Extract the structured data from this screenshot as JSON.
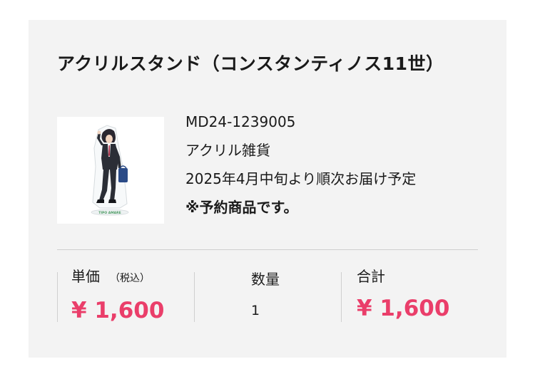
{
  "product": {
    "title": "アクリルスタンド（コンスタンティノス11世）",
    "image_caption": "TIPO AMARE",
    "code": "MD24-1239005",
    "category": "アクリル雑貨",
    "shipping": "2025年4月中旬より順次お届け予定",
    "notice": "※予約商品です。"
  },
  "summary": {
    "unit_price_label": "単価",
    "tax_note": "（税込）",
    "unit_price": "¥ 1,600",
    "quantity_label": "数量",
    "quantity": "1",
    "total_label": "合計",
    "total": "¥ 1,600"
  },
  "colors": {
    "price": "#ea3e6a",
    "card_background": "#f3f3f3"
  }
}
